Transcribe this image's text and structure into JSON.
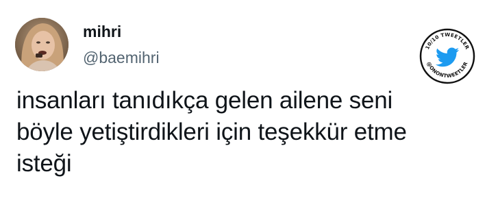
{
  "user": {
    "display_name": "mihri",
    "handle": "@baemihri",
    "avatar": "profile-photo"
  },
  "tweet": {
    "text": "insanları tanıdıkça gelen ailene seni\nböyle yetiştirdikleri için teşekkür etme\nisteği"
  },
  "watermark": {
    "top_text": "10/10 TWEETLER",
    "bottom_text": "@ONONTWEETLER",
    "icon": "twitter-bird-icon",
    "color": "#1d9bf0"
  }
}
